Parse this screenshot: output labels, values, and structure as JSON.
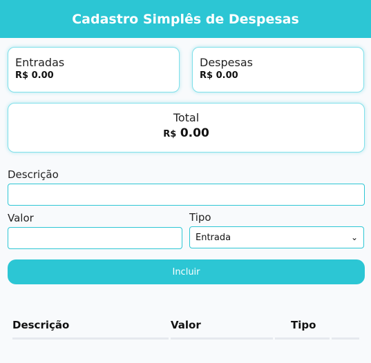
{
  "header": {
    "title": "Cadastro Simplês de Despesas"
  },
  "summary": {
    "entradas": {
      "label": "Entradas",
      "amount": "R$ 0.00"
    },
    "despesas": {
      "label": "Despesas",
      "amount": "R$ 0.00"
    },
    "total": {
      "label": "Total",
      "currency": "R$",
      "value": "0.00"
    }
  },
  "form": {
    "descricao_label": "Descrição",
    "descricao_value": "",
    "valor_label": "Valor",
    "valor_value": "",
    "tipo_label": "Tipo",
    "tipo_selected": "Entrada",
    "submit_label": "Incluir"
  },
  "table": {
    "headers": [
      "Descrição",
      "Valor",
      "Tipo"
    ],
    "rows": []
  },
  "colors": {
    "accent": "#2cc6d4",
    "background": "#f8fafc"
  }
}
